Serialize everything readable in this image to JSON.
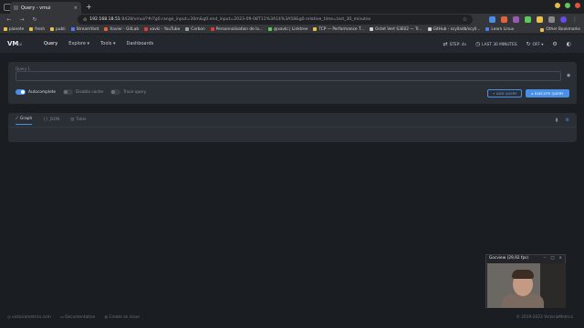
{
  "browser": {
    "tab_title": "Query - vmui",
    "tab_close": "×",
    "new_tab": "+",
    "url_host": "192.168.18.51",
    "url_path": ":8428/vmui/?#/?g0.range_input=30m&g0.end_input=2023-09-08T11%3A14%3A58&g0.relative_time=last_30_minutes",
    "bookmarks": [
      {
        "label": "pianete",
        "color": "#e8c14a"
      },
      {
        "label": "fresh",
        "color": "#e8c14a"
      },
      {
        "label": "publi",
        "color": "#e8c14a"
      },
      {
        "label": "StreamYard",
        "color": "#4a7ee8"
      },
      {
        "label": "Xavier · GitLab",
        "color": "#e2643a"
      },
      {
        "label": "xavki - YouTube",
        "color": "#e23a3a"
      },
      {
        "label": "Carbon",
        "color": "#9aa0a6"
      },
      {
        "label": "Personnalisation de la...",
        "color": "#e23a3a"
      },
      {
        "label": "@xavki | Linktree",
        "color": "#5ec95a"
      },
      {
        "label": "TCP — Performance T...",
        "color": "#e8c14a"
      },
      {
        "label": "Octet Vert S3E02 — Tr...",
        "color": "#cfcfcf"
      },
      {
        "label": "GitHub - scylladb/scyll...",
        "color": "#cfcfcf"
      },
      {
        "label": "Learn Linux",
        "color": "#4a7ee8"
      }
    ],
    "other_bookmarks": "Other Bookmarks"
  },
  "app": {
    "logo": "VM",
    "logo_sub": "ui",
    "nav": [
      "Query",
      "Explore ▾",
      "Tools ▾",
      "Dashboards"
    ],
    "step": "STEP: 4s",
    "time_range": "LAST 30 MINUTES",
    "refresh": "OFF ▾"
  },
  "query": {
    "label": "Query 1",
    "value": "",
    "toggles": [
      "Autocomplete",
      "Disable cache",
      "Trace query"
    ],
    "add_query": "+ ADD QUERY",
    "execute_query": "▸ EXECUTE QUERY"
  },
  "results": {
    "tabs": [
      "Graph",
      "JSON",
      "Table"
    ]
  },
  "footer": {
    "links": [
      "victoriametrics.com",
      "Documentation",
      "Create an issue"
    ],
    "copyright": "© 2019-2023 VictoriaMetrics"
  },
  "gocview": {
    "title": "Gocview (29,92 fps)"
  },
  "colors": {
    "accent": "#4a8fe7",
    "background": "#1a1d22",
    "panel": "#2a2e35"
  }
}
